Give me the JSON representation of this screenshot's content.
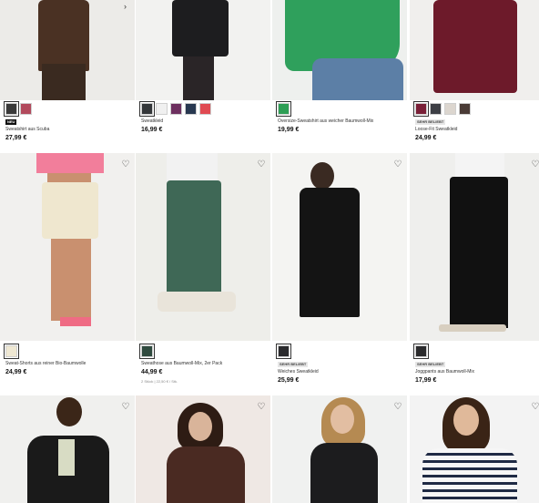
{
  "products": [
    {
      "id": "p1",
      "badge": "NEU",
      "badge_style": "dark",
      "name": "Sweatshirt aus Scuba",
      "price": "27,99 €",
      "swatches": [
        "#3a3a3a",
        "#b24a5d"
      ],
      "selected": 0,
      "photo": "#ecebe8",
      "top": "#4a3123",
      "bottom": "#3a2a20",
      "chevron": true
    },
    {
      "id": "p2",
      "badge": "",
      "badge_style": "",
      "name": "Sweatkleid",
      "price": "16,99 €",
      "swatches": [
        "#34373a",
        "#f0f0f0",
        "#6e3060",
        "#283850",
        "#e04a52"
      ],
      "selected": 0,
      "photo": "#f2f2f0",
      "top": "#1d1d1f",
      "bottom": "#1d1d1f"
    },
    {
      "id": "p3",
      "badge": "",
      "badge_style": "",
      "name": "Oversize-Sweatshirt aus weicher Baumwoll-Mix",
      "price": "19,99 €",
      "swatches": [
        "#2e9e55"
      ],
      "selected": 0,
      "photo": "#eef0ee",
      "top": "#2fa05c",
      "bottom": "#5c7fa6"
    },
    {
      "id": "p4",
      "badge": "SEHR BELIEBT",
      "badge_style": "light",
      "name": "Loose-Fit Sweatkleid",
      "price": "24,99 €",
      "swatches": [
        "#7a2038",
        "#3d3f45",
        "#dcd6cf",
        "#4a3b36"
      ],
      "selected": 0,
      "photo": "#f0efed",
      "top": "#6d1a2a",
      "bottom": "#6d1a2a"
    },
    {
      "id": "p5",
      "badge": "",
      "badge_style": "",
      "name": "Sweat-Shorts aus reiner Bio-Baumwolle",
      "price": "24,99 €",
      "swatches": [
        "#efe8d3"
      ],
      "selected": 0,
      "photo": "#f1f0ee",
      "top": "#f27e9b",
      "bottom": "#efe7cf",
      "heart": true
    },
    {
      "id": "p6",
      "badge": "",
      "badge_style": "",
      "name": "Sweathose aus Baumwoll-Mix, 2er Pack",
      "price": "44,99 €",
      "note": "2 Stück | 22,50 € / Stk.",
      "swatches": [
        "#2f4a3e"
      ],
      "selected": 0,
      "photo": "#eeeeea",
      "top": "#f2f2f2",
      "bottom": "#3f6856",
      "heart": true
    },
    {
      "id": "p7",
      "badge": "SEHR BELIEBT",
      "badge_style": "light",
      "name": "Weiches Sweatkleid",
      "price": "25,99 €",
      "swatches": [
        "#2a2a2d"
      ],
      "selected": 0,
      "photo": "#f4f4f2",
      "top": "#141414",
      "bottom": "#141414",
      "heart": true
    },
    {
      "id": "p8",
      "badge": "SEHR BELIEBT",
      "badge_style": "light",
      "name": "Joggpants aus Baumwoll-Mix",
      "price": "17,99 €",
      "swatches": [
        "#2b2b2d"
      ],
      "selected": 0,
      "photo": "#efefed",
      "top": "#f4f4f4",
      "bottom": "#111111",
      "heart": true
    },
    {
      "id": "p9",
      "photo": "#f0f0ee",
      "top": "#1a1a1a",
      "bottom": "#1a1a1a",
      "heart": true
    },
    {
      "id": "p10",
      "photo": "#efe8e4",
      "top": "#4a2a22",
      "bottom": "#4a2a22",
      "heart": true
    },
    {
      "id": "p11",
      "photo": "#f0f1f0",
      "top": "#1c1c1e",
      "bottom": "#1c1c1e",
      "heart": true
    },
    {
      "id": "p12",
      "photo": "#f3f3f3",
      "top": "#f4f4f4",
      "bottom": "#1f2a44",
      "heart": true
    }
  ]
}
